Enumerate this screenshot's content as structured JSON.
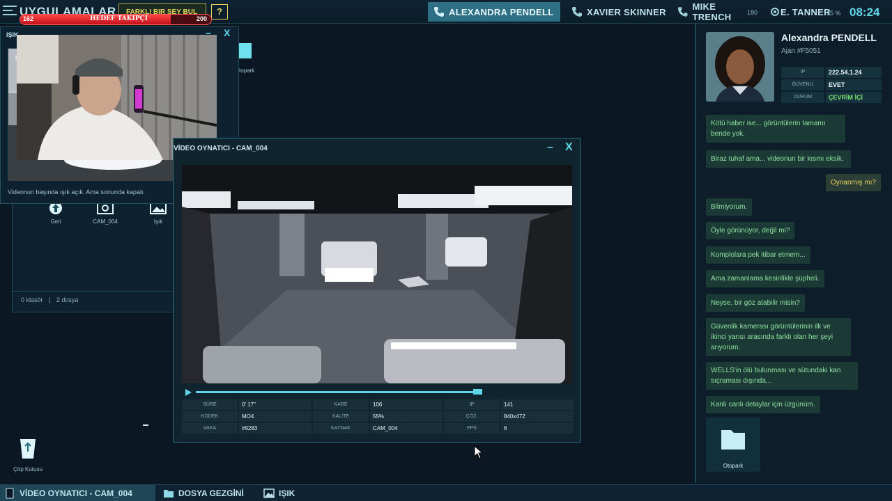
{
  "topbar": {
    "apps_title": "UYGULAMALAR",
    "find_diff_label": "FARKLI BIR ŞEY BUL",
    "help_label": "?",
    "tracker": {
      "label": "HEDEF TAKİPÇİ",
      "min": "162",
      "max": "200",
      "fraction": 0.79
    },
    "contacts": [
      {
        "label": "ALEXANDRA PENDELL",
        "active": true
      },
      {
        "label": "XAVIER SKINNER",
        "active": false
      },
      {
        "label": "MIKE TRENCH",
        "active": false
      },
      {
        "label": "E. TANNER",
        "active": false
      }
    ],
    "system_small": "180",
    "system_pct": "35 %",
    "clock": "08:24"
  },
  "chat": {
    "agent_name": "Alexandra PENDELL",
    "agent_id": "Ajan #F5051",
    "info": [
      {
        "key": "IP",
        "value": "222.54.1.24"
      },
      {
        "key": "GÜVENLİ",
        "value": "EVET"
      },
      {
        "key": "DURUM",
        "value": "ÇEVRİM İÇİ"
      }
    ],
    "messages": [
      {
        "text": "Kötü haber ise... görüntülerin tamamı bende yok.",
        "from": "in"
      },
      {
        "text": "Biraz tuhaf ama... videonun bir kısmı eksik.",
        "from": "in"
      },
      {
        "text": "Oynanmış mı?",
        "from": "out"
      },
      {
        "text": "Bilmiyorum.",
        "from": "in"
      },
      {
        "text": "Öyle görünüyor, değil mi?",
        "from": "in"
      },
      {
        "text": "Komplolara pek itibar etmem...",
        "from": "in"
      },
      {
        "text": "Ama zamanlama kesinlikle şüpheli.",
        "from": "in"
      },
      {
        "text": "Neyse, bir göz atabilir misin?",
        "from": "in"
      },
      {
        "text": "Güvenlik kamerası görüntülerinin ilk ve ikinci yarısı arasında farklı olan her şeyi arıyorum.",
        "from": "in"
      },
      {
        "text": "WELLS'in ölü bulunması ve sütundaki kan sıçraması dışında...",
        "from": "in"
      },
      {
        "text": "Kanlı canlı detaylar için üzgünüm.",
        "from": "in"
      }
    ],
    "folder_label": "Otopark"
  },
  "explorer": {
    "icons": [
      {
        "label": "Geri"
      },
      {
        "label": "CAM_004"
      },
      {
        "label": "Işık"
      }
    ],
    "status_folders": "0 klasör",
    "status_sep": "|",
    "status_files": "2 dosya"
  },
  "light_window": {
    "title": "IŞIK",
    "caption": "Videonun başında ışık açık. Ama sonunda kapalı.",
    "min": "–",
    "close": "X"
  },
  "desktop": {
    "otopark_label": "Otopark",
    "trash_label": "Çöp Kutusu"
  },
  "player": {
    "title": "VİDEO OYNATICI - CAM_004",
    "min": "–",
    "close": "X",
    "progress": 0.98,
    "stats": [
      {
        "key": "SÜRE",
        "value": "0' 17\""
      },
      {
        "key": "KARE",
        "value": "106"
      },
      {
        "key": "IP",
        "value": "141"
      },
      {
        "key": "KODEK",
        "value": "MO4"
      },
      {
        "key": "KALİTE",
        "value": "55%"
      },
      {
        "key": "ÇÖZ.",
        "value": "840x472"
      },
      {
        "key": "VAKA",
        "value": "#9283"
      },
      {
        "key": "KAYNAK",
        "value": "CAM_004"
      },
      {
        "key": "FPS",
        "value": "6"
      }
    ]
  },
  "taskbar": {
    "items": [
      {
        "label": "VİDEO OYNATICI - CAM_004",
        "active": true
      },
      {
        "label": "DOSYA GEZGİNİ",
        "active": false
      },
      {
        "label": "IŞIK",
        "active": false
      }
    ]
  },
  "colors": {
    "accent": "#5fd6e8",
    "chat_in_text": "#8fe0a0",
    "chat_out_text": "#f0d060",
    "online": "#79e06c",
    "tracker": "#e0161f"
  }
}
